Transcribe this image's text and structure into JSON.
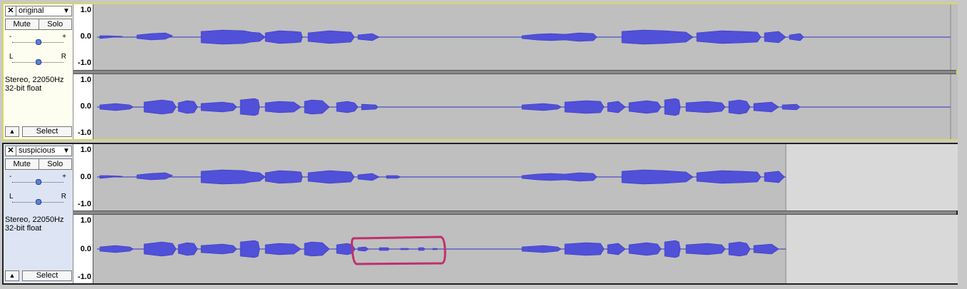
{
  "tracks": [
    {
      "name": "original",
      "close_label": "✕",
      "menu_arrow": "▼",
      "mute_label": "Mute",
      "solo_label": "Solo",
      "gain_minus": "-",
      "gain_plus": "+",
      "pan_left": "L",
      "pan_right": "R",
      "info_line1": "Stereo, 22050Hz",
      "info_line2": "32-bit float",
      "collapse_icon": "▲",
      "select_label": "Select",
      "scale_top": "1.0",
      "scale_mid": "0.0",
      "scale_bot": "-1.0"
    },
    {
      "name": "suspicious",
      "close_label": "✕",
      "menu_arrow": "▼",
      "mute_label": "Mute",
      "solo_label": "Solo",
      "gain_minus": "-",
      "gain_plus": "+",
      "pan_left": "L",
      "pan_right": "R",
      "info_line1": "Stereo, 22050Hz",
      "info_line2": "32-bit float",
      "collapse_icon": "▲",
      "select_label": "Select",
      "scale_top": "1.0",
      "scale_mid": "0.0",
      "scale_bot": "-1.0"
    }
  ],
  "colors": {
    "waveform": "#3232c8",
    "highlight_box": "#c0306a",
    "selected_track_border": "#d8d860"
  }
}
